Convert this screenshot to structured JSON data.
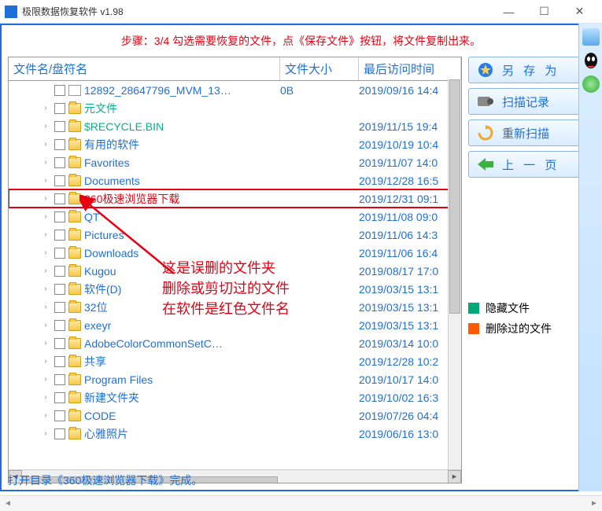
{
  "titlebar": {
    "title": "极限数据恢复软件 v1.98"
  },
  "instruction": "步骤：3/4 勾选需要恢复的文件，点《保存文件》按钮，将文件复制出来。",
  "columns": {
    "name": "文件名/盘符名",
    "size": "文件大小",
    "time": "最后访问时间"
  },
  "rows": [
    {
      "expand": "",
      "type": "file",
      "name": "12892_28647796_MVM_13…",
      "size": "0B",
      "time": "2019/09/16 14:4",
      "cls": ""
    },
    {
      "expand": "›",
      "type": "folder",
      "name": "元文件",
      "size": "",
      "time": "",
      "cls": "special"
    },
    {
      "expand": "›",
      "type": "folder",
      "name": "$RECYCLE.BIN",
      "size": "",
      "time": "2019/11/15 19:4",
      "cls": "special"
    },
    {
      "expand": "›",
      "type": "folder",
      "name": "有用的软件",
      "size": "",
      "time": "2019/10/19 10:4",
      "cls": ""
    },
    {
      "expand": "›",
      "type": "folder",
      "name": "Favorites",
      "size": "",
      "time": "2019/11/07 14:0",
      "cls": ""
    },
    {
      "expand": "›",
      "type": "folder",
      "name": "Documents",
      "size": "",
      "time": "2019/12/28 16:5",
      "cls": ""
    },
    {
      "expand": "›",
      "type": "folder",
      "name": "360极速浏览器下载",
      "size": "",
      "time": "2019/12/31 09:1",
      "cls": "deleted highlight"
    },
    {
      "expand": "›",
      "type": "folder",
      "name": "QT",
      "size": "",
      "time": "2019/11/08 09:0",
      "cls": ""
    },
    {
      "expand": "›",
      "type": "folder",
      "name": "Pictures",
      "size": "",
      "time": "2019/11/06 14:3",
      "cls": ""
    },
    {
      "expand": "›",
      "type": "folder",
      "name": "Downloads",
      "size": "",
      "time": "2019/11/06 16:4",
      "cls": ""
    },
    {
      "expand": "›",
      "type": "folder",
      "name": "Kugou",
      "size": "",
      "time": "2019/08/17 17:0",
      "cls": ""
    },
    {
      "expand": "›",
      "type": "folder",
      "name": "软件(D)",
      "size": "",
      "time": "2019/03/15 13:1",
      "cls": ""
    },
    {
      "expand": "›",
      "type": "folder",
      "name": "32位",
      "size": "",
      "time": "2019/03/15 13:1",
      "cls": ""
    },
    {
      "expand": "›",
      "type": "folder",
      "name": "exeyr",
      "size": "",
      "time": "2019/03/15 13:1",
      "cls": ""
    },
    {
      "expand": "›",
      "type": "folder",
      "name": "AdobeColorCommonSetC…",
      "size": "",
      "time": "2019/03/14 10:0",
      "cls": ""
    },
    {
      "expand": "›",
      "type": "folder",
      "name": "共享",
      "size": "",
      "time": "2019/12/28 10:2",
      "cls": ""
    },
    {
      "expand": "›",
      "type": "folder",
      "name": "Program Files",
      "size": "",
      "time": "2019/10/17 14:0",
      "cls": ""
    },
    {
      "expand": "›",
      "type": "folder",
      "name": "新建文件夹",
      "size": "",
      "time": "2019/10/02 16:3",
      "cls": ""
    },
    {
      "expand": "›",
      "type": "folder",
      "name": "CODE",
      "size": "",
      "time": "2019/07/26 04:4",
      "cls": ""
    },
    {
      "expand": "›",
      "type": "folder",
      "name": "心雅照片",
      "size": "",
      "time": "2019/06/16 13:0",
      "cls": ""
    }
  ],
  "annotation": {
    "line1": "这是误删的文件夹",
    "line2": "删除或剪切过的文件",
    "line3": "在软件是红色文件名"
  },
  "sidebar": {
    "save": "另 存 为",
    "scanlog": "扫描记录",
    "rescan": "重新扫描",
    "prev": "上 一 页"
  },
  "legend": {
    "hidden": {
      "label": "隐藏文件",
      "color": "#00a878"
    },
    "deleted": {
      "label": "删除过的文件",
      "color": "#ff5a00"
    }
  },
  "status": "打开目录《360极速浏览器下载》完成。"
}
